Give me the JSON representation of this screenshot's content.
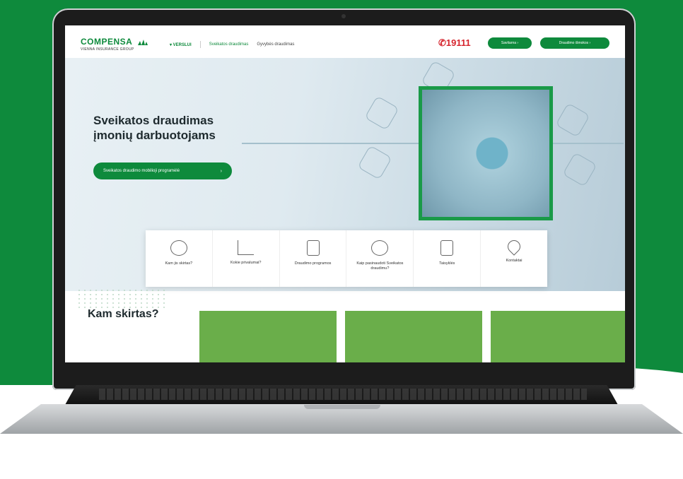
{
  "brand": {
    "name": "COMPENSA",
    "sub": "VIENNA INSURANCE GROUP"
  },
  "nav": {
    "items": [
      {
        "label": "▾ VERSLUI"
      },
      {
        "label": "Sveikatos draudimas"
      },
      {
        "label": "Gyvybės draudimas"
      }
    ],
    "phone": "19111",
    "buttons": [
      {
        "label": "Savitarna"
      },
      {
        "label": "Draudimo išmokos"
      }
    ]
  },
  "hero": {
    "title_line1": "Sveikatos draudimas",
    "title_line2": "įmonių darbuotojams",
    "cta": "Sveikatos draudimo mobilioji programėlė",
    "cta_arrow": "›"
  },
  "quick_links": [
    {
      "label": "Kam jis skirtas?",
      "icon": "target-icon"
    },
    {
      "label": "Kokie privalumai?",
      "icon": "bar-chart-icon"
    },
    {
      "label": "Draudimo programos",
      "icon": "clipboard-icon"
    },
    {
      "label": "Kaip pasinaudoti Sveikatos draudimu?",
      "icon": "info-icon"
    },
    {
      "label": "Taisyklės",
      "icon": "document-icon"
    },
    {
      "label": "Kontaktai",
      "icon": "location-pin-icon"
    }
  ],
  "section": {
    "title": "Kam skirtas?"
  },
  "colors": {
    "brand_green": "#0e8a3c",
    "phone_red": "#d6252e"
  }
}
